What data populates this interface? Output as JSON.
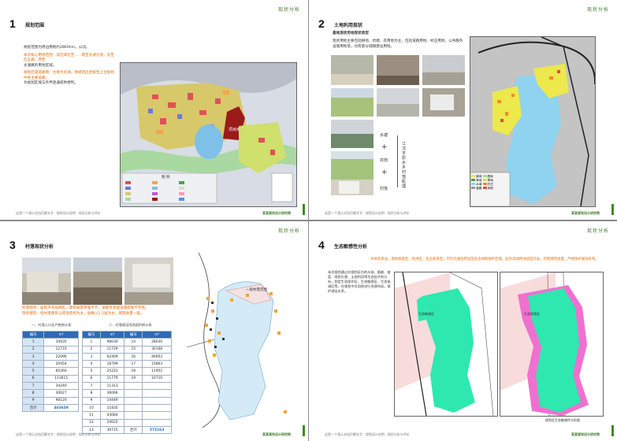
{
  "header_label": "现状分析",
  "footer_text": "这是一个演示文档页脚文字 · 规划设计说明 · 现状分析与评价",
  "footer_right": "某某规划设计研究院",
  "pages": [
    {
      "number": "1",
      "title": "规划范围",
      "paragraphs": [
        "规划范围为周边用地约2860hm，公顷。",
        "本次核心用地范围：该区域北至……南至太湖大道，东至红五路，西至",
        "太湖路的用地区域。",
        "规划区域道路网：主要为太湖，将规划区连接至上位规划中各主要道路，",
        "为规划区域与外界连通提供便利。"
      ],
      "map_legend_title": "图  例",
      "map_site_label": "项目用地"
    },
    {
      "number": "2",
      "title": "土地利用现状",
      "subtitle": "基地现状用地现状类型",
      "intro": "现状用地主要包括耕地、坑塘、农用地为主，包括道路用地、村庄用地、公共服务设施用地等，也有部分城镇建设用地。",
      "flow": [
        "水塘",
        "农田",
        "村落"
      ],
      "flow_result": "江汉平原水乡村落肌理",
      "legend": [
        "耕地",
        "园地",
        "林地",
        "草地",
        "水域",
        "村庄",
        "道路",
        "其他"
      ]
    },
    {
      "number": "3",
      "title": "村落现状分析",
      "notes": [
        "村落现状：居民点布局散乱，建筑质量参差不齐，道路等基础设施配套不完善。",
        "现状建筑：各村落建筑以砖混结构为主，层数以1-2层为主，建筑质量一般。"
      ],
      "table1_caption": "一、村落人口及户数统计表",
      "table2_caption": "二、村落建设用地面积统计表",
      "table1": {
        "headers": [
          "编号",
          "m²"
        ],
        "rows": [
          [
            "1",
            "10635"
          ],
          [
            "2",
            "12710"
          ],
          [
            "3",
            "22096"
          ],
          [
            "4",
            "20454"
          ],
          [
            "5",
            "60360"
          ],
          [
            "6",
            "113615"
          ],
          [
            "7",
            "34240"
          ],
          [
            "8",
            "30627"
          ],
          [
            "9",
            "98120"
          ],
          [
            "合计",
            "403659"
          ]
        ]
      },
      "table2": {
        "headers": [
          "编号",
          "m²",
          "编号",
          "m²"
        ],
        "rows": [
          [
            "1",
            "98030",
            "14",
            "28030"
          ],
          [
            "2",
            "11729",
            "15",
            "30108"
          ],
          [
            "3",
            "62409",
            "16",
            "46953"
          ],
          [
            "4",
            "18799",
            "17",
            "15863"
          ],
          [
            "5",
            "25222",
            "18",
            "11952"
          ],
          [
            "6",
            "11779",
            "19",
            "10710"
          ],
          [
            "7",
            "11313",
            "",
            ""
          ],
          [
            "8",
            "36066",
            "",
            ""
          ],
          [
            "9",
            "14449",
            "",
            ""
          ],
          [
            "10",
            "11835",
            "",
            ""
          ],
          [
            "11",
            "43084",
            "",
            ""
          ],
          [
            "12",
            "24022",
            "",
            ""
          ],
          [
            "13",
            "30715",
            "合计",
            "572163"
          ]
        ]
      },
      "map_label": "一般村落范围"
    },
    {
      "number": "4",
      "title": "生态敏感性分析",
      "banner": "水体及周边、湿地保育区、防洪区、生态保育区，可作为湖泊周边及生态绿地保护区域，此外滨湖用地适度开发，控制建筑密度，严格保护湖泊水系。",
      "desc": "本次规划通过对规划区内的水体、植被、坡度、地质灾害、土地利用等生态因子的分析，划定生态保护区、生态敏感区、生态协调区等，在规划中对用地进行合理布局，保护湖泊水系。",
      "map_label_a": "生态敏感区",
      "map_label_b": "生态保育区",
      "footer_map": "规划区生态敏感性分析图"
    }
  ],
  "colors": {
    "accent_green": "#3f8a1f",
    "orange": "#e86a00",
    "table_head": "#2f6bb3",
    "water": "#8fd3f0",
    "eco_green": "#2ee8b0",
    "eco_pink": "#f070d0"
  }
}
